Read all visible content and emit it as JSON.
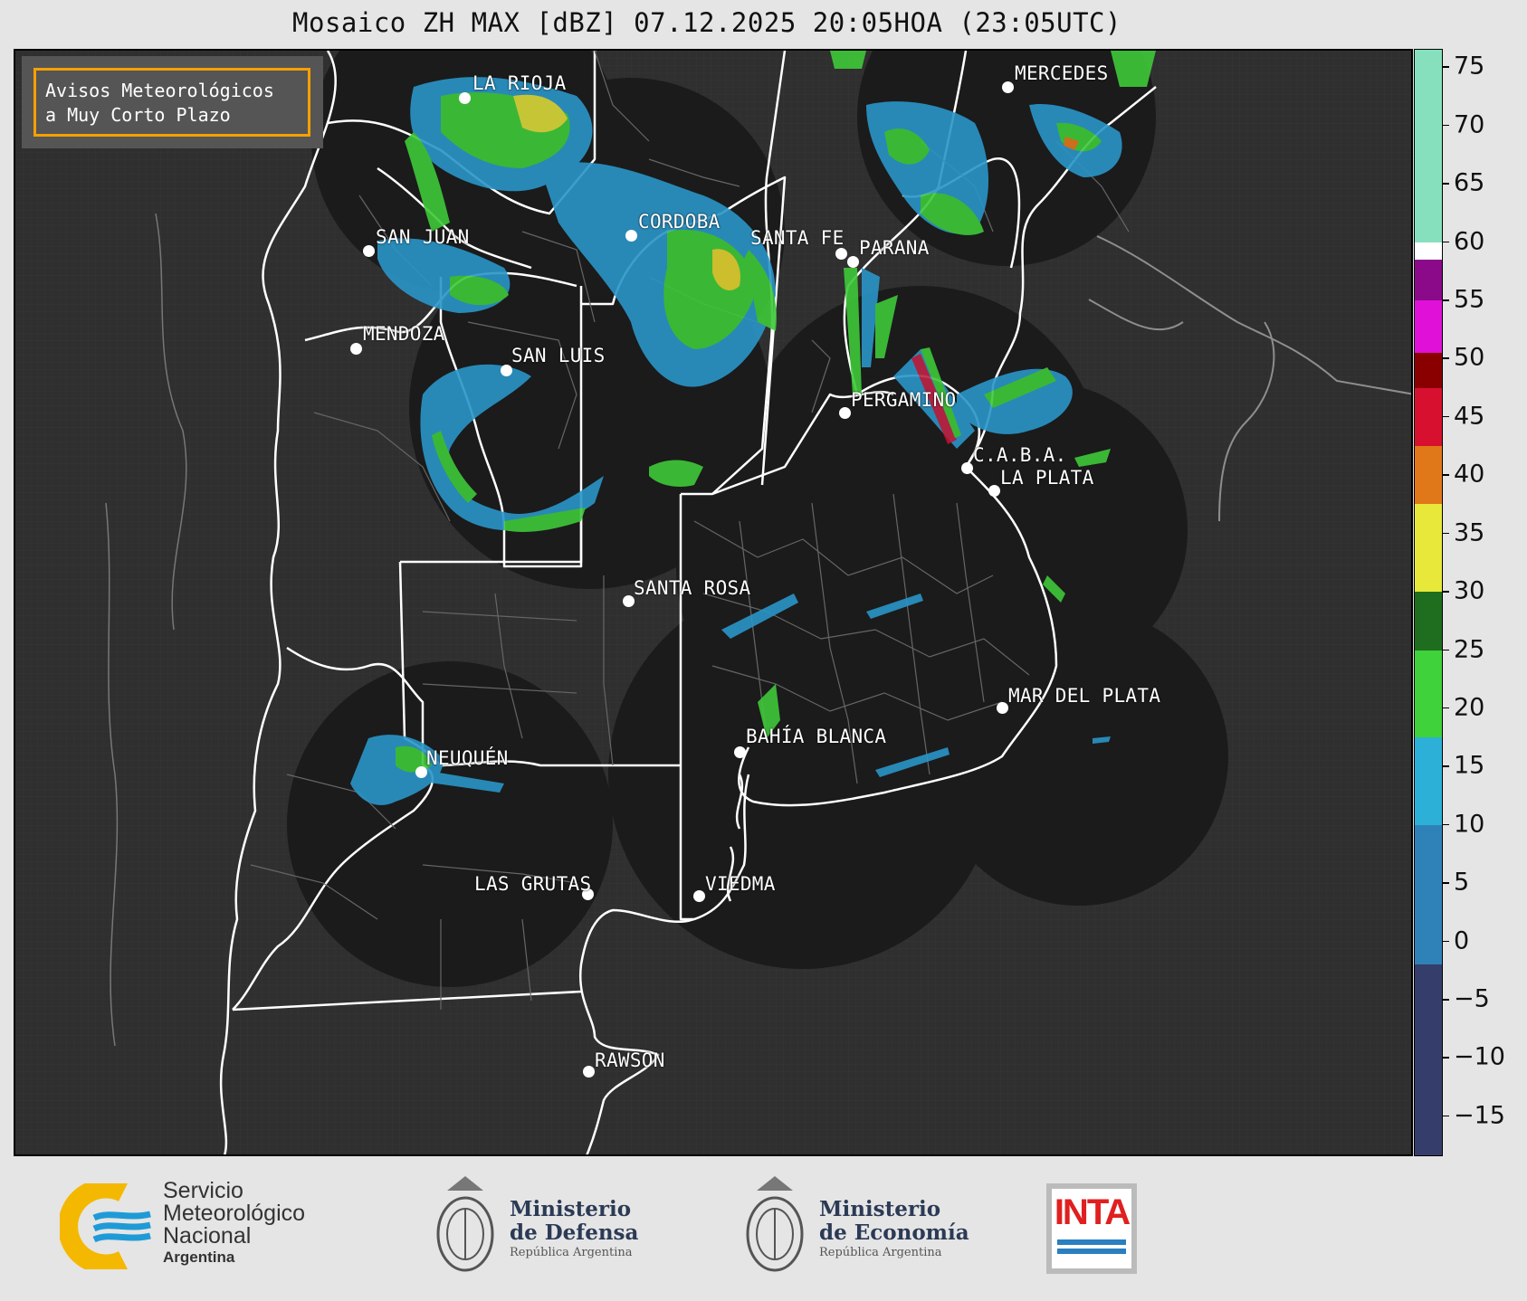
{
  "title": "Mosaico ZH MAX [dBZ] 07.12.2025 20:05HOA (23:05UTC)",
  "avisos": {
    "line1": "Avisos Meteorológicos",
    "line2": "a Muy Corto Plazo"
  },
  "cities": {
    "la_rioja": "LA RIOJA",
    "san_juan": "SAN JUAN",
    "cordoba": "CORDOBA",
    "santa_fe": "SANTA FE",
    "parana": "PARANA",
    "mercedes": "MERCEDES",
    "mendoza": "MENDOZA",
    "san_luis": "SAN LUIS",
    "pergamino": "PERGAMINO",
    "caba": "C.A.B.A.",
    "la_plata": "LA PLATA",
    "santa_rosa": "SANTA ROSA",
    "mar_del_plata": "MAR DEL PLATA",
    "bahia_blanca": "BAHÍA BLANCA",
    "neuquen": "NEUQUÉN",
    "las_grutas": "LAS GRUTAS",
    "viedma": "VIEDMA",
    "rawson": "RAWSON"
  },
  "colorbar": {
    "unit": "dBZ",
    "ticks": [
      "75",
      "70",
      "65",
      "60",
      "55",
      "50",
      "45",
      "40",
      "35",
      "30",
      "25",
      "20",
      "15",
      "10",
      "5",
      "0",
      "−5",
      "−10",
      "−15"
    ],
    "range": [
      -18.5,
      76.5
    ],
    "colors": {
      "low": "#353d6a",
      "blue": "#2f82b8",
      "cyan": "#2cb0d8",
      "green": "#3fd23a",
      "darkgreen": "#1f6e1f",
      "yellow": "#e8e83a",
      "orange": "#e0781a",
      "red": "#d81030",
      "darkred": "#8a0000",
      "magenta": "#e010d8",
      "purple": "#8a0a8a",
      "white": "#ffffff",
      "mint": "#86e0bd"
    }
  },
  "footer": {
    "smn": {
      "line1": "Servicio",
      "line2": "Meteorológico",
      "line3": "Nacional",
      "line4": "Argentina"
    },
    "defensa": {
      "line1": "Ministerio",
      "line2": "de Defensa",
      "line3": "República Argentina"
    },
    "economia": {
      "line1": "Ministerio",
      "line2": "de Economía",
      "line3": "República Argentina"
    },
    "inta": "INTA"
  }
}
